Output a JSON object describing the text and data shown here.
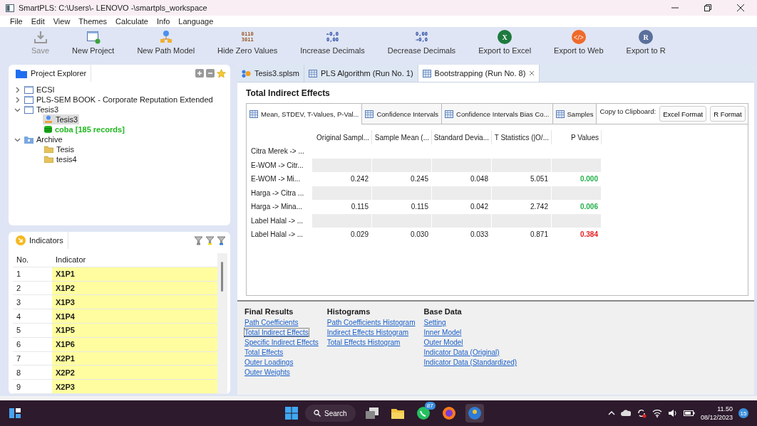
{
  "window": {
    "title": "SmartPLS: C:\\Users\\- LENOVO -\\smartpls_workspace"
  },
  "menu": [
    "File",
    "Edit",
    "View",
    "Themes",
    "Calculate",
    "Info",
    "Language"
  ],
  "toolbar": [
    {
      "label": "Save",
      "kind": "save",
      "disabled": true
    },
    {
      "label": "New Project",
      "kind": "project",
      "disabled": false
    },
    {
      "label": "New Path Model",
      "kind": "model",
      "disabled": false
    },
    {
      "label": "Hide Zero Values",
      "kind": "digits",
      "glyph": [
        "0110",
        "3011"
      ],
      "disabled": false
    },
    {
      "label": "Increase Decimals",
      "kind": "increase",
      "glyph": [
        "←0,0",
        "0,00"
      ],
      "disabled": false
    },
    {
      "label": "Decrease Decimals",
      "kind": "decrease",
      "glyph": [
        "0,00",
        "→0,0"
      ],
      "disabled": false
    },
    {
      "label": "Export to Excel",
      "kind": "excel",
      "glyph": [
        "X"
      ],
      "disabled": false
    },
    {
      "label": "Export to Web",
      "kind": "web",
      "glyph": [
        "</>"
      ],
      "disabled": false
    },
    {
      "label": "Export to R",
      "kind": "r",
      "glyph": [
        "R"
      ],
      "disabled": false
    }
  ],
  "project_explorer": {
    "title": "Project Explorer",
    "items": [
      {
        "label": "ECSI",
        "kind": "project",
        "expanded": false,
        "selected": false
      },
      {
        "label": "PLS-SEM BOOK - Corporate Reputation Extended",
        "kind": "project",
        "expanded": false,
        "selected": false
      },
      {
        "label": "Tesis3",
        "kind": "project",
        "expanded": true,
        "selected": false,
        "children": [
          {
            "label": "Tesis3",
            "kind": "model",
            "selected": true
          },
          {
            "label": "coba [185 records]",
            "kind": "data",
            "selected": false
          }
        ]
      },
      {
        "label": "Archive",
        "kind": "archive",
        "expanded": true,
        "selected": false,
        "children": [
          {
            "label": "Tesis",
            "kind": "folder",
            "selected": false
          },
          {
            "label": "tesis4",
            "kind": "folder",
            "selected": false
          }
        ]
      }
    ]
  },
  "indicators": {
    "title": "Indicators",
    "columns": [
      "No.",
      "Indicator"
    ],
    "rows": [
      {
        "no": "1",
        "indicator": "X1P1"
      },
      {
        "no": "2",
        "indicator": "X1P2"
      },
      {
        "no": "3",
        "indicator": "X1P3"
      },
      {
        "no": "4",
        "indicator": "X1P4"
      },
      {
        "no": "5",
        "indicator": "X1P5"
      },
      {
        "no": "6",
        "indicator": "X1P6"
      },
      {
        "no": "7",
        "indicator": "X2P1"
      },
      {
        "no": "8",
        "indicator": "X2P2"
      },
      {
        "no": "9",
        "indicator": "X2P3"
      }
    ]
  },
  "editor_tabs": [
    {
      "label": "Tesis3.splsm",
      "kind": "model",
      "selected": false
    },
    {
      "label": "PLS Algorithm (Run No. 1)",
      "kind": "table",
      "selected": false
    },
    {
      "label": "Bootstrapping (Run No. 8)",
      "kind": "table",
      "selected": true
    }
  ],
  "results": {
    "title": "Total Indirect Effects",
    "subtabs": [
      {
        "label": "Mean, STDEV, T-Values, P-Val...",
        "selected": true
      },
      {
        "label": "Confidence Intervals",
        "selected": false
      },
      {
        "label": "Confidence Intervals Bias Co...",
        "selected": false
      },
      {
        "label": "Samples",
        "selected": false
      }
    ],
    "copy_label": "Copy to Clipboard:",
    "buttons": [
      "Excel Format",
      "R Format"
    ],
    "table": {
      "columns": [
        "Original Sampl...",
        "Sample Mean (...",
        "Standard Devia...",
        "T Statistics (|O/...",
        "P Values"
      ],
      "rows": [
        {
          "label": "Citra Merek -> ..."
        },
        {
          "label": "E-WOM -> Citr..."
        },
        {
          "label": "E-WOM -> Mi...",
          "cells": [
            "0.242",
            "0.245",
            "0.048",
            "5.051"
          ],
          "p_value": "0.000",
          "significant": true
        },
        {
          "label": "Harga -> Citra ..."
        },
        {
          "label": "Harga -> Mina...",
          "cells": [
            "0.115",
            "0.115",
            "0.042",
            "2.742"
          ],
          "p_value": "0.006",
          "significant": true
        },
        {
          "label": "Label Halal -> ..."
        },
        {
          "label": "Label Halal -> ...",
          "cells": [
            "0.029",
            "0.030",
            "0.033",
            "0.871"
          ],
          "p_value": "0.384",
          "significant": false
        }
      ]
    }
  },
  "link_sections": [
    {
      "title": "Final Results",
      "links": [
        {
          "label": "Path Coefficients",
          "selected": false
        },
        {
          "label": "Total Indirect Effects",
          "selected": true
        },
        {
          "label": "Specific Indirect Effects",
          "selected": false
        },
        {
          "label": "Total Effects",
          "selected": false
        },
        {
          "label": "Outer Loadings",
          "selected": false
        },
        {
          "label": "Outer Weights",
          "selected": false
        }
      ]
    },
    {
      "title": "Histograms",
      "links": [
        {
          "label": "Path Coefficients Histogram",
          "selected": false
        },
        {
          "label": "Indirect Effects Histogram",
          "selected": false
        },
        {
          "label": "Total Effects Histogram",
          "selected": false
        }
      ]
    },
    {
      "title": "Base Data",
      "links": [
        {
          "label": "Setting",
          "selected": false
        },
        {
          "label": "Inner Model",
          "selected": false
        },
        {
          "label": "Outer Model",
          "selected": false
        },
        {
          "label": "Indicator Data (Original)",
          "selected": false
        },
        {
          "label": "Indicator Data (Standardized)",
          "selected": false
        }
      ]
    }
  ],
  "taskbar": {
    "search": "Search",
    "whatsapp_badge": "87",
    "time": "11.50",
    "date": "08/12/2023",
    "notifications": "15"
  }
}
